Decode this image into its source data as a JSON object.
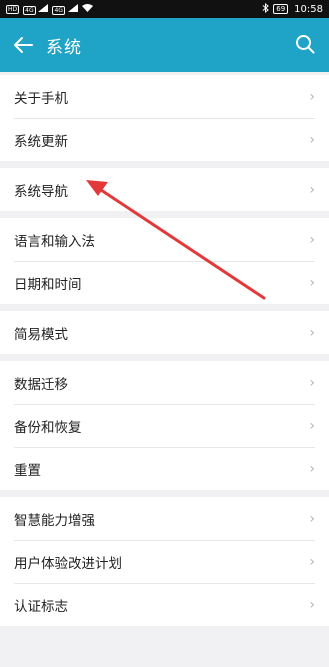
{
  "status_bar": {
    "left_chips": [
      "HD",
      "4G",
      "4G"
    ],
    "battery": "69",
    "time": "10:58"
  },
  "appbar": {
    "title": "系统",
    "back_icon": "arrow-left-icon",
    "search_icon": "search-icon"
  },
  "groups": [
    {
      "items": [
        {
          "label": "关于手机"
        },
        {
          "label": "系统更新"
        }
      ]
    },
    {
      "items": [
        {
          "label": "系统导航"
        }
      ]
    },
    {
      "items": [
        {
          "label": "语言和输入法"
        },
        {
          "label": "日期和时间"
        }
      ]
    },
    {
      "items": [
        {
          "label": "简易模式"
        }
      ]
    },
    {
      "items": [
        {
          "label": "数据迁移"
        },
        {
          "label": "备份和恢复"
        },
        {
          "label": "重置"
        }
      ]
    },
    {
      "items": [
        {
          "label": "智慧能力增强"
        },
        {
          "label": "用户体验改进计划"
        },
        {
          "label": "认证标志"
        }
      ]
    }
  ],
  "colors": {
    "appbar": "#1fa3c6",
    "annotation_arrow": "#e23a3a"
  }
}
